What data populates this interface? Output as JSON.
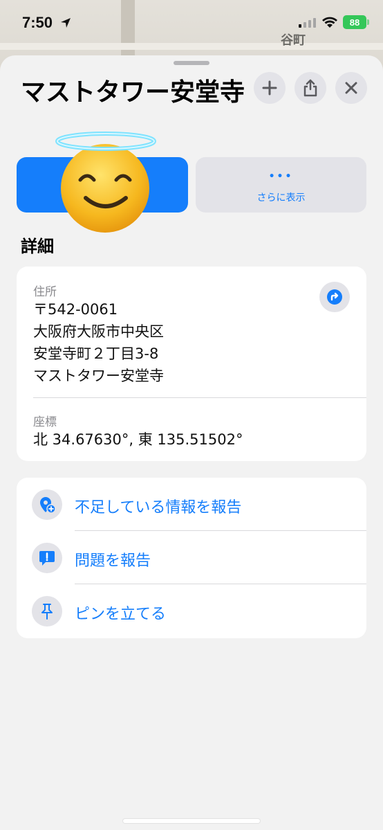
{
  "status_bar": {
    "time": "7:50",
    "battery": "88"
  },
  "map": {
    "label": "谷町"
  },
  "place": {
    "title": "マストタワー安堂寺"
  },
  "actions": {
    "more_icon": "•••",
    "more_label": "さらに表示"
  },
  "details": {
    "section_title": "詳細",
    "address_label": "住所",
    "address_lines": [
      "〒542-0061",
      "大阪府大阪市中央区",
      "安堂寺町２丁目3-8",
      "マストタワー安堂寺"
    ],
    "coordinates_label": "座標",
    "coordinates_value": "北 34.67630°, 東 135.51502°"
  },
  "options": [
    {
      "label": "不足している情報を報告",
      "icon": "add-location-icon"
    },
    {
      "label": "問題を報告",
      "icon": "report-bubble-icon"
    },
    {
      "label": "ピンを立てる",
      "icon": "pin-icon"
    }
  ],
  "colors": {
    "accent": "#157efb",
    "battery": "#34c759"
  }
}
